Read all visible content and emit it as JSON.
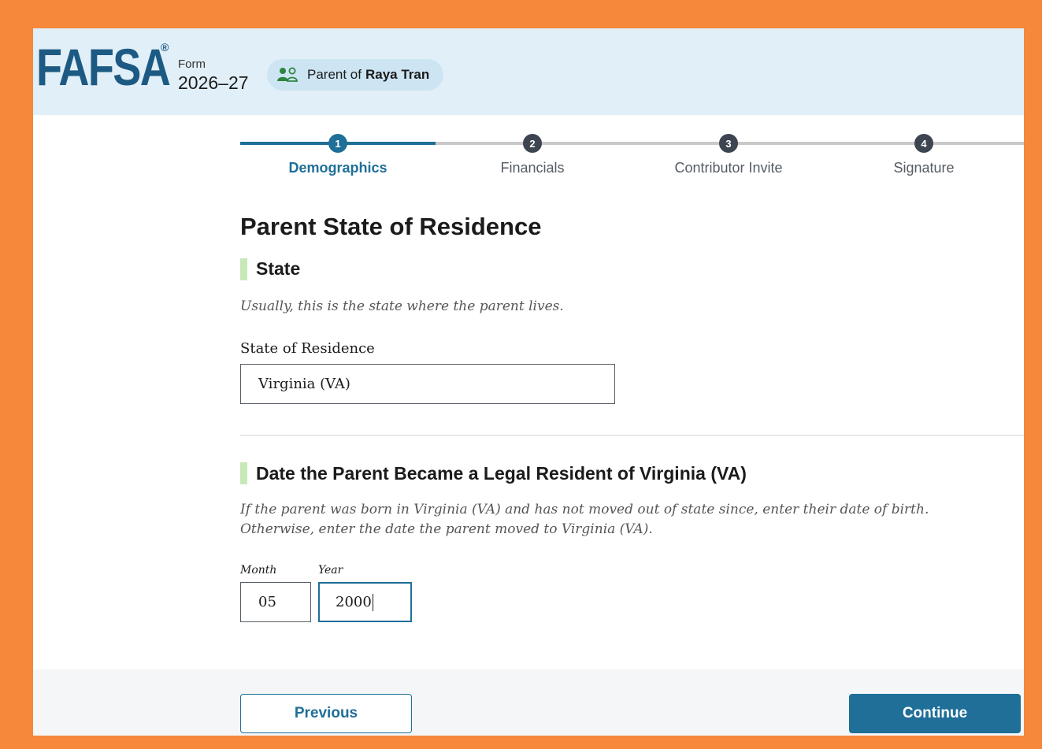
{
  "header": {
    "logo": "FAFSA",
    "reg_mark": "®",
    "form_label": "Form",
    "form_year": "2026–27",
    "role_prefix": "Parent of",
    "student_name": "Raya Tran"
  },
  "steps": [
    {
      "number": "1",
      "label": "Demographics",
      "state": "current"
    },
    {
      "number": "2",
      "label": "Financials",
      "state": "upcoming"
    },
    {
      "number": "3",
      "label": "Contributor Invite",
      "state": "upcoming"
    },
    {
      "number": "4",
      "label": "Signature",
      "state": "upcoming"
    }
  ],
  "page": {
    "title": "Parent State of Residence"
  },
  "state_section": {
    "title": "State",
    "hint": "Usually, this is the state where the parent lives.",
    "field_label": "State of Residence",
    "field_value": "Virginia (VA)"
  },
  "date_section": {
    "title": "Date the Parent Became a Legal Resident of Virginia (VA)",
    "hint_line1": "If the parent was born in Virginia (VA) and has not moved out of state since, enter their date of birth.",
    "hint_line2": "Otherwise, enter the date the parent moved to Virginia (VA).",
    "month_label": "Month",
    "month_value": "05",
    "year_label": "Year",
    "year_value": "2000"
  },
  "footer": {
    "previous_label": "Previous",
    "continue_label": "Continue"
  },
  "colors": {
    "outer_border": "#f5883a",
    "header_bg": "#e1eff8",
    "primary": "#1f6f98",
    "section_accent": "#c8e8b8",
    "icon_green": "#2e8540"
  }
}
